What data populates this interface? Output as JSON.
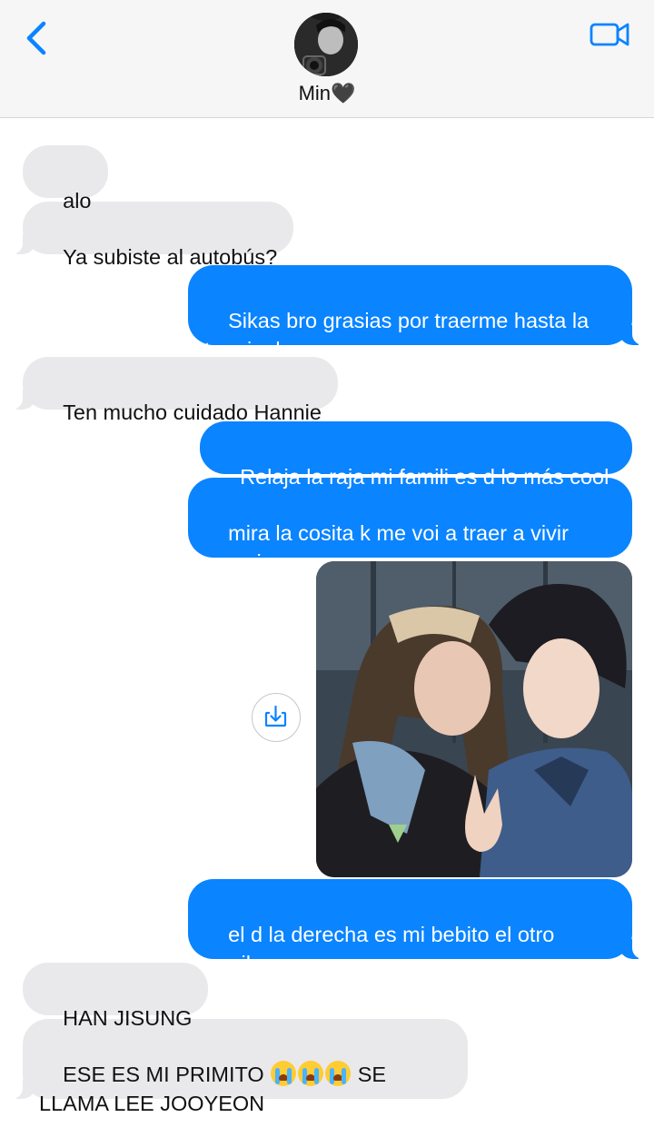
{
  "header": {
    "contact_name": "Min🖤",
    "back_icon": "chevron-left-icon",
    "video_icon": "video-camera-icon",
    "accent_color": "#0a84ff"
  },
  "messages": [
    {
      "from": "them",
      "text": "alo"
    },
    {
      "from": "them",
      "text": "Ya subiste al autobús?"
    },
    {
      "from": "me",
      "text": "Sikas bro grasias por traerme hasta la\nterminal"
    },
    {
      "from": "them",
      "text": "Ten mucho cuidado Hannie"
    },
    {
      "from": "me",
      "text": "Relaja la raja mi famili es d lo más cool"
    },
    {
      "from": "me",
      "text": "mira la cosita k me voi a traer a vivir\nconmigo"
    },
    {
      "from": "me",
      "type": "image",
      "description_icon": "photo-attachment"
    },
    {
      "from": "me",
      "text": "el d la derecha es mi bebito el otro\nmarihuano no se qn es"
    },
    {
      "from": "them",
      "text": "HAN JISUNG"
    },
    {
      "from": "them",
      "text_part1": "ESE ES MI PRIMITO ",
      "emoji": "😭😭😭",
      "text_part2": " SE\nLLAMA LEE JOOYEON"
    }
  ],
  "colors": {
    "incoming_bubble": "#e9e9eb",
    "outgoing_bubble": "#0a84ff",
    "header_bg": "#f6f6f6"
  }
}
